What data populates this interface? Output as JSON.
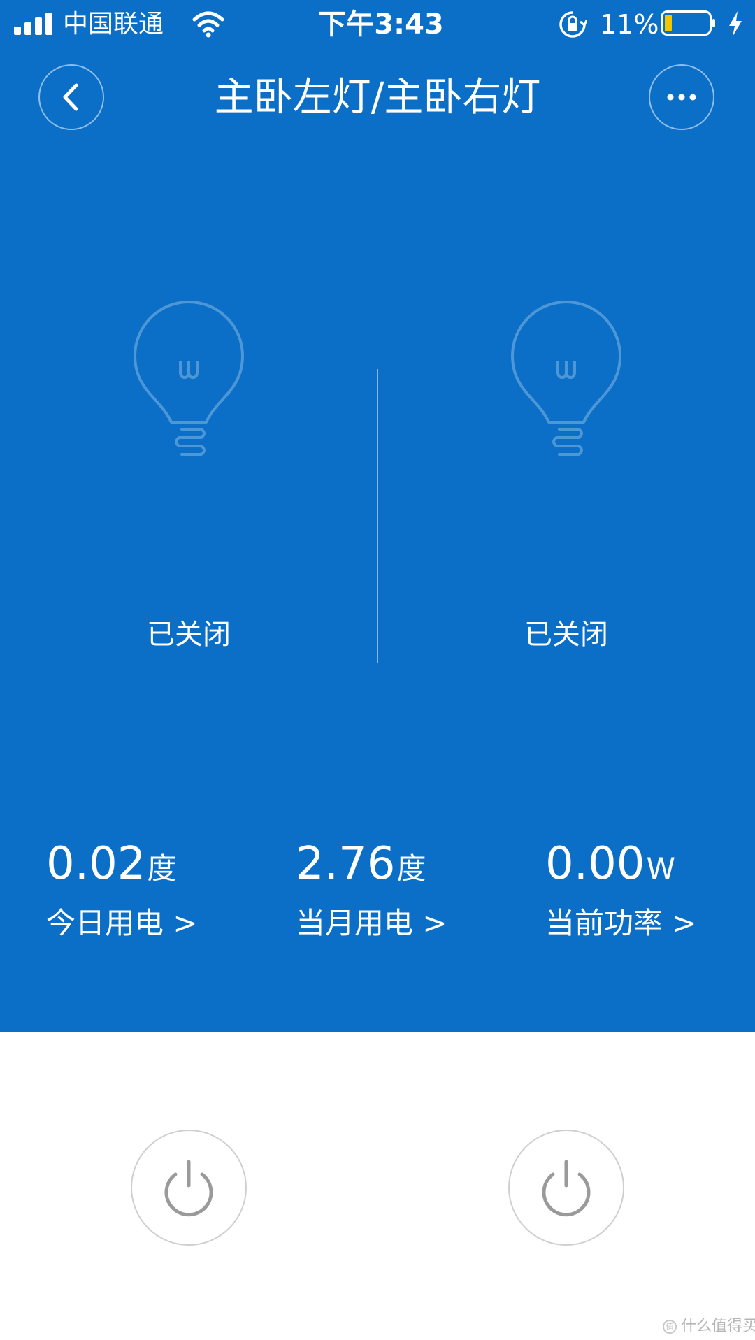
{
  "status_bar": {
    "carrier": "中国联通",
    "time": "下午3:43",
    "battery_percent": "11%",
    "icons": [
      "signal-icon",
      "wifi-icon",
      "rotation-lock-icon",
      "battery-icon",
      "charging-icon"
    ]
  },
  "header": {
    "title": "主卧左灯/主卧右灯",
    "back_icon": "chevron-left-icon",
    "more_icon": "more-dots-icon"
  },
  "lamps": [
    {
      "icon": "light-bulb-icon",
      "status": "已关闭"
    },
    {
      "icon": "light-bulb-icon",
      "status": "已关闭"
    }
  ],
  "stats": [
    {
      "value": "0.02",
      "unit": "度",
      "label": "今日用电 >"
    },
    {
      "value": "2.76",
      "unit": "度",
      "label": "当月用电 >"
    },
    {
      "value": "0.00",
      "unit": "W",
      "label": "当前功率 >"
    }
  ],
  "controls": {
    "power_icon": "power-icon"
  },
  "watermark": {
    "text": "什么值得买",
    "badge": "值"
  },
  "colors": {
    "primary": "#0b6fc8",
    "background": "#ffffff",
    "power_button_border": "#cfcfcf",
    "power_icon": "#9a9a9a",
    "battery_fill": "#f5c400"
  }
}
